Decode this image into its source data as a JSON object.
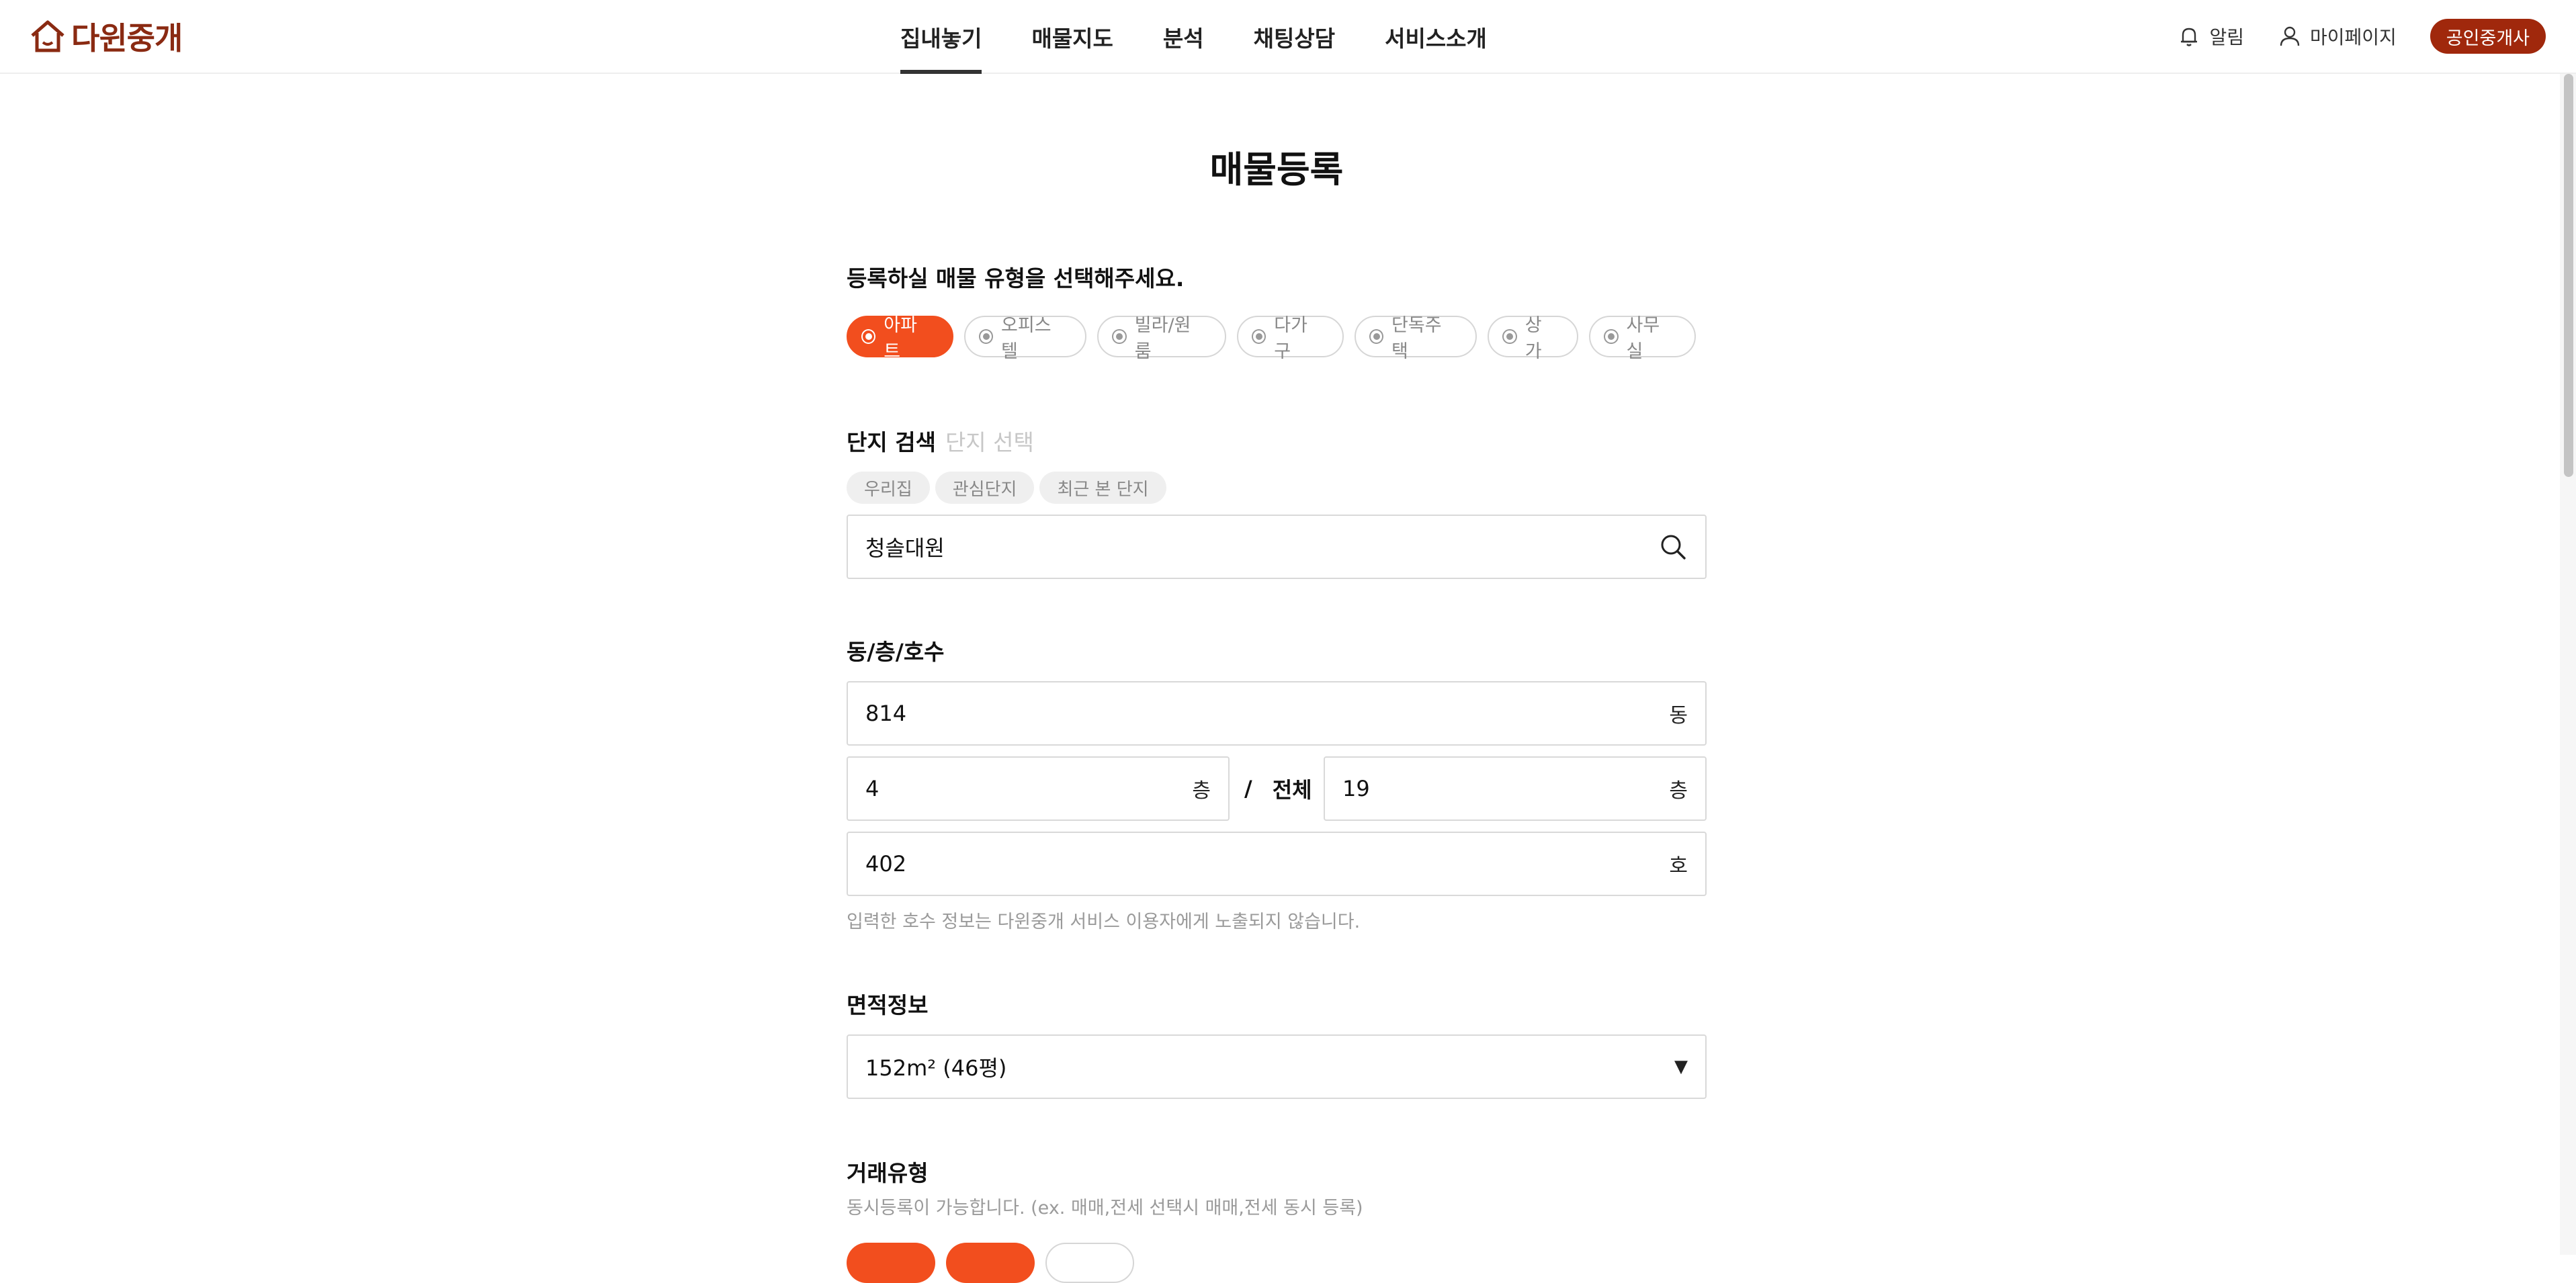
{
  "header": {
    "logo_text": "다윈중개",
    "nav": [
      "집내놓기",
      "매물지도",
      "분석",
      "채팅상담",
      "서비스소개"
    ],
    "active_nav": 0,
    "notification_label": "알림",
    "mypage_label": "마이페이지",
    "agent_button": "공인중개사",
    "brand_color": "#a0280c"
  },
  "page": {
    "title": "매물등록",
    "accent_color": "#f24e1e"
  },
  "property_type": {
    "label": "등록하실 매물 유형을 선택해주세요.",
    "options": [
      "아파트",
      "오피스텔",
      "빌라/원룸",
      "다가구",
      "단독주택",
      "상가",
      "사무실"
    ],
    "selected": "아파트"
  },
  "complex_search": {
    "label": "단지 검색",
    "sublabel": "단지 선택",
    "tags": [
      "우리집",
      "관심단지",
      "최근 본 단지"
    ],
    "value": "청솔대원",
    "icon": "search-icon"
  },
  "unit_info": {
    "label": "동/층/호수",
    "building": "814",
    "building_unit": "동",
    "floor": "4",
    "floor_unit": "층",
    "separator": "/",
    "total_label": "전체",
    "total_floors": "19",
    "total_floors_unit": "층",
    "room": "402",
    "room_unit": "호",
    "hint": "입력한 호수 정보는 다윈중개 서비스 이용자에게 노출되지 않습니다."
  },
  "area": {
    "label": "면적정보",
    "selected": "152m² (46평)",
    "caret": "▼"
  },
  "deal_type": {
    "label": "거래유형",
    "hint": "동시등록이 가능합니다. (ex. 매매,전세 선택시 매매,전세 동시 등록)"
  }
}
